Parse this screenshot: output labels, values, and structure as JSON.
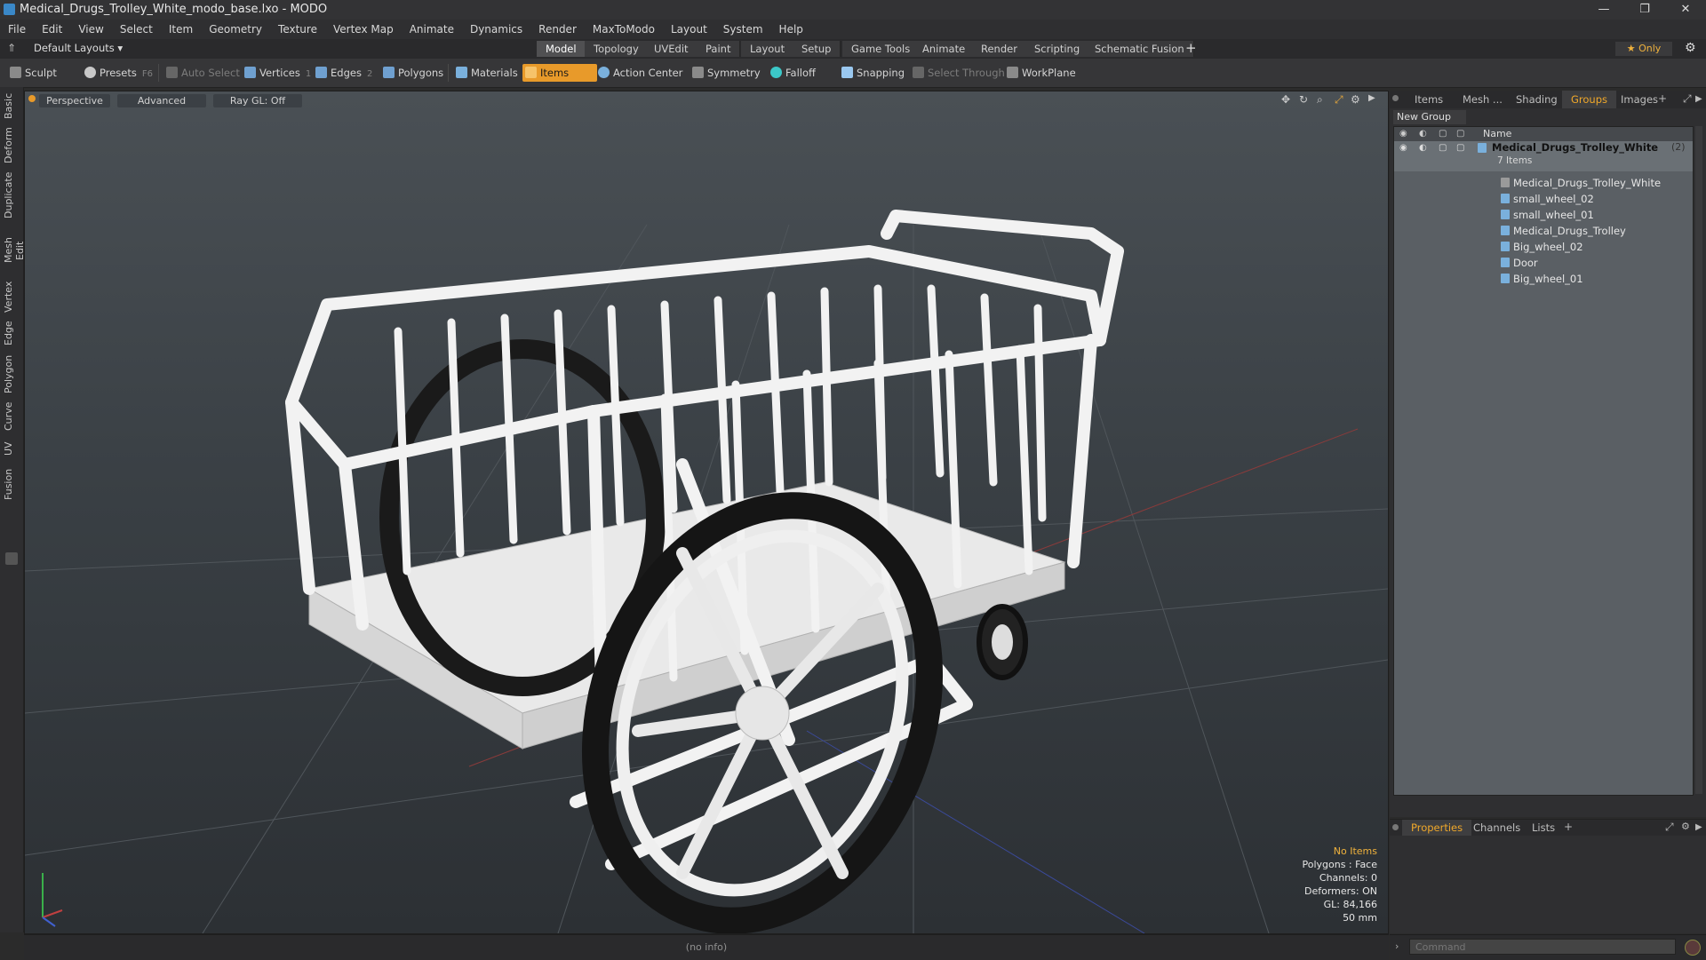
{
  "window": {
    "title": "Medical_Drugs_Trolley_White_modo_base.lxo - MODO",
    "controls": {
      "minimize": "—",
      "restore": "❐",
      "close": "✕"
    }
  },
  "menu": [
    "File",
    "Edit",
    "View",
    "Select",
    "Item",
    "Geometry",
    "Texture",
    "Vertex Map",
    "Animate",
    "Dynamics",
    "Render",
    "MaxToModo",
    "Layout",
    "System",
    "Help"
  ],
  "layouts": {
    "dropdown": "Default Layouts ▾",
    "tabs": [
      "Model",
      "Topology",
      "UVEdit",
      "Paint",
      "Layout",
      "Setup",
      "Game Tools",
      "Animate",
      "Render",
      "Scripting",
      "Schematic Fusion"
    ],
    "active": "Model",
    "add": "+",
    "only_label": "★  Only",
    "gear": "⚙"
  },
  "toolbar": {
    "sculpt": "Sculpt",
    "presets": "Presets",
    "presets_key": "F6",
    "auto_select": "Auto Select",
    "vertices": "Vertices",
    "vertices_num": "1",
    "edges": "Edges",
    "edges_num": "2",
    "polygons": "Polygons",
    "materials": "Materials",
    "items": "Items",
    "action_center": "Action Center",
    "symmetry": "Symmetry",
    "falloff": "Falloff",
    "snapping": "Snapping",
    "select_through": "Select Through",
    "workplane": "WorkPlane"
  },
  "left_tabs": [
    "Basic",
    "Deform",
    "Duplicate",
    "Mesh Edit",
    "Vertex",
    "Edge",
    "Polygon",
    "Curve",
    "UV",
    "Fusion"
  ],
  "viewport": {
    "view_mode": "Perspective",
    "shading": "Advanced",
    "raygl": "Ray GL: Off",
    "info": {
      "selection": "No Items",
      "polygons": "Polygons : Face",
      "channels": "Channels: 0",
      "deformers": "Deformers: ON",
      "gl": "GL: 84,166",
      "scale": "50 mm"
    }
  },
  "panel": {
    "tabs": [
      "Items",
      "Mesh ...",
      "Shading",
      "Groups",
      "Images"
    ],
    "active_tab": "Groups",
    "new_group": "New Group",
    "name_header": "Name",
    "group_name": "Medical_Drugs_Trolley_White",
    "group_count": "(2)",
    "group_items_count": "7 Items",
    "items": [
      "Medical_Drugs_Trolley_White",
      "small_wheel_02",
      "small_wheel_01",
      "Medical_Drugs_Trolley",
      "Big_wheel_02",
      "Door",
      "Big_wheel_01"
    ]
  },
  "properties": {
    "tabs": [
      "Properties",
      "Channels",
      "Lists"
    ],
    "active_tab": "Properties",
    "add": "+"
  },
  "status": {
    "info": "(no info)",
    "command_placeholder": "Command"
  },
  "colors": {
    "accent": "#e89a2a",
    "panel": "#2f2f31",
    "viewport_top": "#4a5055",
    "viewport_bottom": "#2c3034"
  }
}
